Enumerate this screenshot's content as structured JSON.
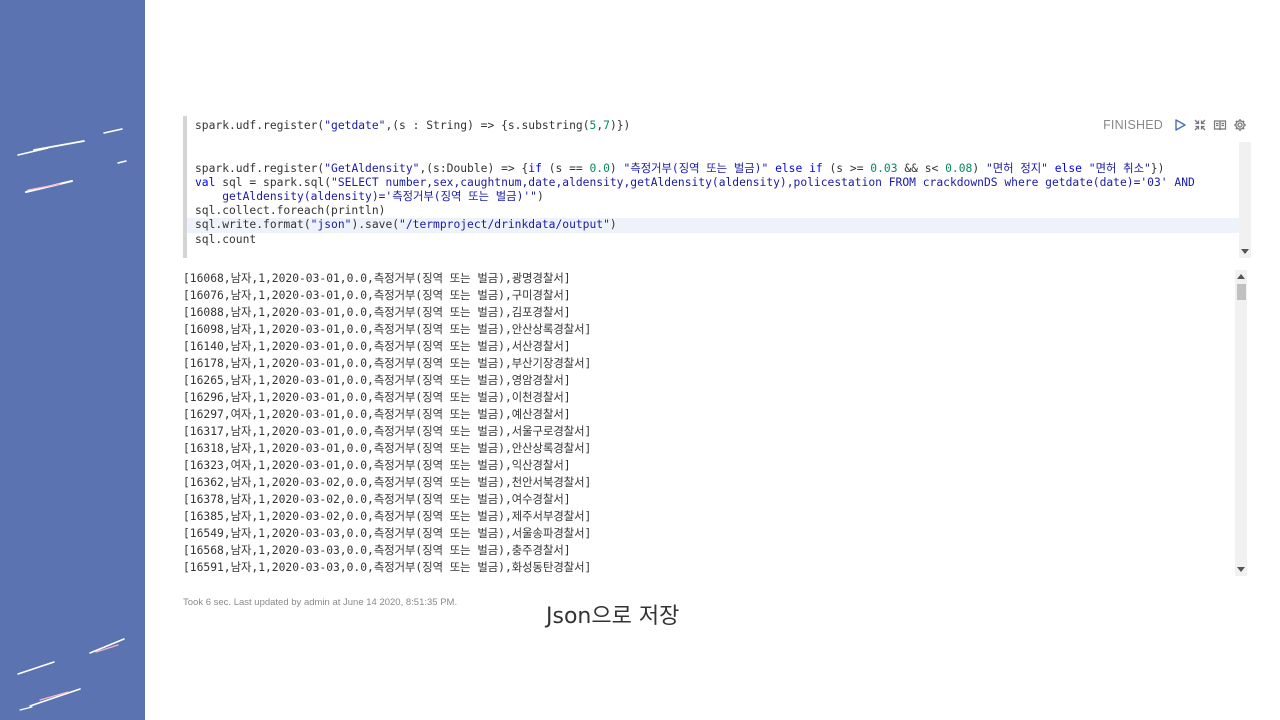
{
  "paragraph": {
    "status": "FINISHED",
    "code_lines": [
      [
        {
          "t": "spark.udf.register("
        },
        {
          "t": "\"getdate\"",
          "c": "str"
        },
        {
          "t": ",(s : String) => {s.substring("
        },
        {
          "t": "5",
          "c": "num"
        },
        {
          "t": ","
        },
        {
          "t": "7",
          "c": "num"
        },
        {
          "t": ")})"
        }
      ],
      [],
      [],
      [
        {
          "t": "spark.udf.register("
        },
        {
          "t": "\"GetAldensity\"",
          "c": "str"
        },
        {
          "t": ",(s:Double) => {"
        },
        {
          "t": "if",
          "c": "kw"
        },
        {
          "t": " (s == "
        },
        {
          "t": "0.0",
          "c": "num"
        },
        {
          "t": ") "
        },
        {
          "t": "\"측정거부(징역 또는 벌금)\"",
          "c": "str"
        },
        {
          "t": " "
        },
        {
          "t": "else if",
          "c": "kw"
        },
        {
          "t": " (s >= "
        },
        {
          "t": "0.03",
          "c": "num"
        },
        {
          "t": " && s< "
        },
        {
          "t": "0.08",
          "c": "num"
        },
        {
          "t": ") "
        },
        {
          "t": "\"면허 정지\"",
          "c": "str"
        },
        {
          "t": " "
        },
        {
          "t": "else",
          "c": "kw"
        },
        {
          "t": " "
        },
        {
          "t": "\"면허 취소\"",
          "c": "str"
        },
        {
          "t": "})"
        }
      ],
      [
        {
          "t": "val",
          "c": "kw"
        },
        {
          "t": " sql = spark.sql("
        },
        {
          "t": "\"SELECT number,sex,caughtnum,date,aldensity,getAldensity(aldensity),policestation FROM crackdownDS where getdate(date)='03' AND",
          "c": "str"
        }
      ],
      [
        {
          "t": "    getAldensity(aldensity)='측정거부(징역 또는 벌금)'\"",
          "c": "str"
        },
        {
          "t": ")"
        }
      ],
      [
        {
          "t": "sql.collect.foreach(println)"
        }
      ],
      [
        {
          "t": "sql.write.format("
        },
        {
          "t": "\"json\"",
          "c": "str"
        },
        {
          "t": ").save("
        },
        {
          "t": "\"/termproject/drinkdata/output\"",
          "c": "str"
        },
        {
          "t": ")"
        }
      ],
      [
        {
          "t": "sql.count"
        }
      ]
    ],
    "output_lines": [
      "[16068,남자,1,2020-03-01,0.0,측정거부(징역 또는 벌금),광명경찰서]",
      "[16076,남자,1,2020-03-01,0.0,측정거부(징역 또는 벌금),구미경찰서]",
      "[16088,남자,1,2020-03-01,0.0,측정거부(징역 또는 벌금),김포경찰서]",
      "[16098,남자,1,2020-03-01,0.0,측정거부(징역 또는 벌금),안산상록경찰서]",
      "[16140,남자,1,2020-03-01,0.0,측정거부(징역 또는 벌금),서산경찰서]",
      "[16178,남자,1,2020-03-01,0.0,측정거부(징역 또는 벌금),부산기장경찰서]",
      "[16265,남자,1,2020-03-01,0.0,측정거부(징역 또는 벌금),영암경찰서]",
      "[16296,남자,1,2020-03-01,0.0,측정거부(징역 또는 벌금),이천경찰서]",
      "[16297,여자,1,2020-03-01,0.0,측정거부(징역 또는 벌금),예산경찰서]",
      "[16317,남자,1,2020-03-01,0.0,측정거부(징역 또는 벌금),서울구로경찰서]",
      "[16318,남자,1,2020-03-01,0.0,측정거부(징역 또는 벌금),안산상록경찰서]",
      "[16323,여자,1,2020-03-01,0.0,측정거부(징역 또는 벌금),익산경찰서]",
      "[16362,남자,1,2020-03-02,0.0,측정거부(징역 또는 벌금),천안서북경찰서]",
      "[16378,남자,1,2020-03-02,0.0,측정거부(징역 또는 벌금),여수경찰서]",
      "[16385,남자,1,2020-03-02,0.0,측정거부(징역 또는 벌금),제주서부경찰서]",
      "[16549,남자,1,2020-03-03,0.0,측정거부(징역 또는 벌금),서울송파경찰서]",
      "[16568,남자,1,2020-03-03,0.0,측정거부(징역 또는 벌금),충주경찰서]",
      "[16591,남자,1,2020-03-03,0.0,측정거부(징역 또는 벌금),화성동탄경찰서]"
    ],
    "footer": "Took 6 sec. Last updated by admin at June 14 2020, 8:51:35 PM."
  },
  "icons": {
    "run": "play-icon",
    "hide_editor": "expand-icon",
    "hide_output": "book-icon",
    "settings": "gear-icon"
  },
  "caption": "Json으로 저장",
  "colors": {
    "sidebar": "#5b73b0",
    "string": "#1a1aa6",
    "keyword": "#0000ff",
    "number": "#09885a"
  }
}
